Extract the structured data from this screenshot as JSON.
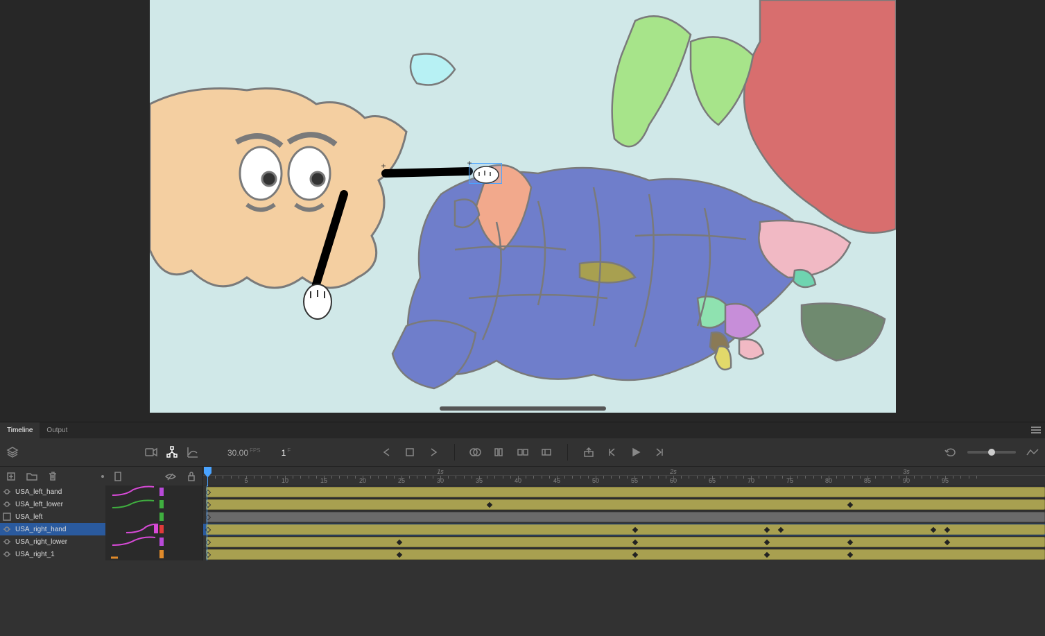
{
  "tabs": {
    "timeline": "Timeline",
    "output": "Output"
  },
  "fps": "30.00",
  "fps_label": "FPS",
  "frame": "1",
  "frame_label": "F",
  "ruler_seconds": [
    "1s",
    "2s",
    "3s"
  ],
  "ruler_frames": [
    "5",
    "10",
    "15",
    "20",
    "25",
    "30",
    "35",
    "40",
    "45",
    "50",
    "55",
    "60",
    "65",
    "70",
    "75",
    "80",
    "85",
    "90",
    "95"
  ],
  "layers": [
    {
      "name": "USA_left_hand",
      "icon": "symbol",
      "color": "#b84ad9",
      "bar": "olive",
      "selected": false,
      "curve": "magenta",
      "keyframes": []
    },
    {
      "name": "USA_left_lower",
      "icon": "symbol",
      "color": "#3fae3f",
      "bar": "olive",
      "selected": false,
      "curve": "green",
      "keyframes": [
        410,
        930
      ]
    },
    {
      "name": "USA_left",
      "icon": "graphic",
      "color": "#3fae3f",
      "bar": "gray",
      "selected": false,
      "curve": "",
      "keyframes": []
    },
    {
      "name": "USA_right_hand",
      "icon": "symbol",
      "color": "#e03a3a",
      "bar": "olive",
      "selected": true,
      "curve": "red",
      "keyframes": [
        620,
        810,
        830,
        1050,
        1070
      ]
    },
    {
      "name": "USA_right_lower",
      "icon": "symbol",
      "color": "#b84ad9",
      "bar": "olive",
      "selected": false,
      "curve": "magenta2",
      "keyframes": [
        280,
        620,
        810,
        930,
        1070
      ]
    },
    {
      "name": "USA_right_1",
      "icon": "symbol",
      "color": "#e08a2a",
      "bar": "olive",
      "selected": false,
      "curve": "orange",
      "keyframes": [
        280,
        620,
        810,
        930
      ]
    }
  ]
}
